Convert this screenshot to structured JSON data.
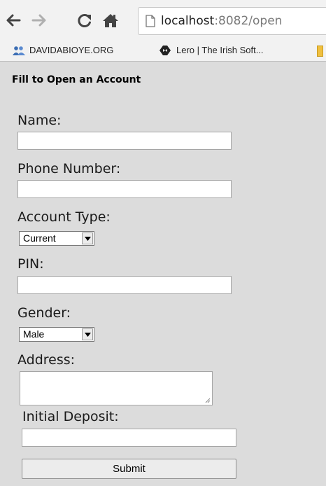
{
  "browser": {
    "url_host": "localhost",
    "url_path": ":8082/open",
    "bookmarks": [
      {
        "label": "DAVIDABIOYE.ORG",
        "icon": "people-icon"
      },
      {
        "label": "Lero | The Irish Soft...",
        "icon": "lero-logo-icon"
      }
    ]
  },
  "form": {
    "title": "Fill to Open an Account",
    "name_label": "Name:",
    "name_value": "",
    "phone_label": "Phone Number:",
    "phone_value": "",
    "account_type_label": "Account Type:",
    "account_type_value": "Current",
    "pin_label": "PIN:",
    "pin_value": "",
    "gender_label": "Gender:",
    "gender_value": "Male",
    "address_label": "Address:",
    "deposit_label": "Initial Deposit:",
    "deposit_value": "",
    "submit_label": "Submit"
  },
  "colors": {
    "page_background": "#dcdcdc",
    "chrome_background": "#f2f2f2",
    "icon_grey": "#444444"
  }
}
